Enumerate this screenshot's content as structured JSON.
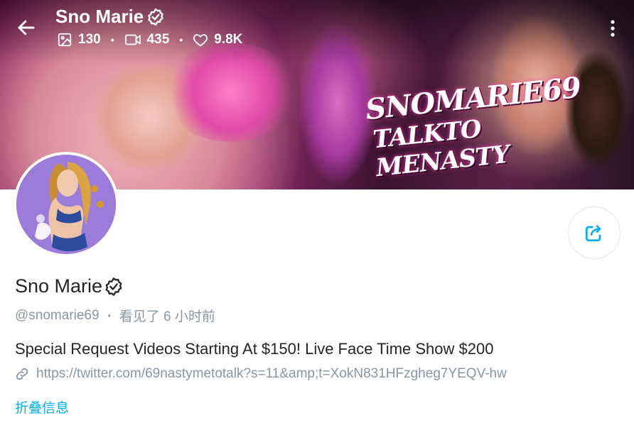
{
  "header": {
    "title": "Sno Marie",
    "back_icon": "arrow-left-icon",
    "stats": {
      "photos": "130",
      "videos": "435",
      "likes": "9.8K"
    },
    "menu_icon": "more-vertical-icon"
  },
  "banner": {
    "logo_line1": "SNOMARIE69",
    "logo_line2": "TALKTO MENASTY"
  },
  "profile": {
    "name": "Sno Marie",
    "handle": "@snomarie69",
    "last_seen": "看见了  6 小时前",
    "bio": "Special Request Videos Starting At $150! Live Face Time Show $200",
    "link": "https://twitter.com/69nastymetotalk?s=11&amp;t=XokN831HFzgheg7YEQV-hw",
    "collapse_label": "折叠信息"
  },
  "colors": {
    "accent": "#00aff0",
    "muted": "#8a96a3",
    "text": "#242529"
  }
}
